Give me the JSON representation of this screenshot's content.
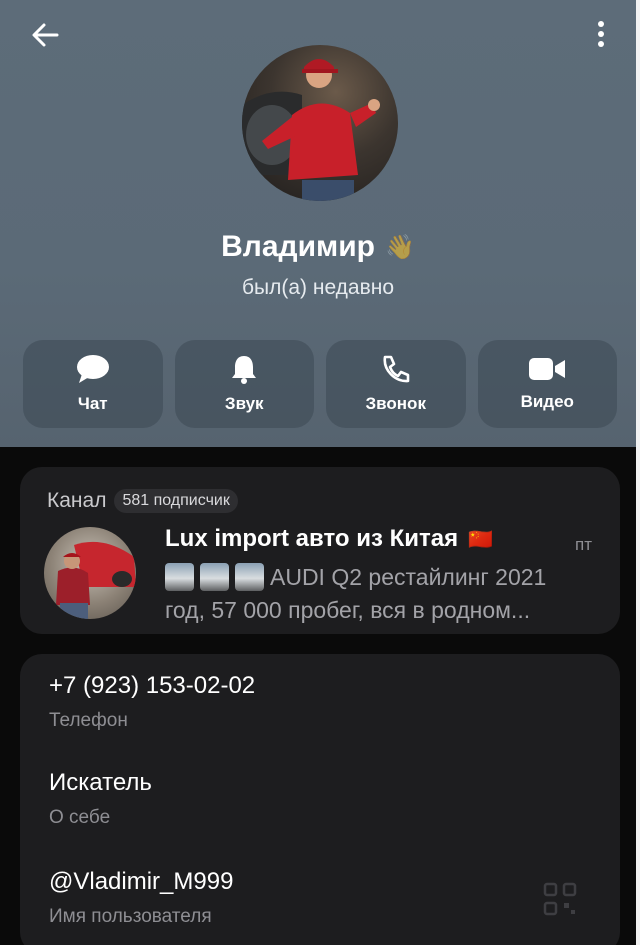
{
  "profile": {
    "name": "Владимир",
    "status": "был(а) недавно",
    "name_emoji": "👋"
  },
  "actions": [
    {
      "label": "Чат",
      "icon": "chat-bubble-icon"
    },
    {
      "label": "Звук",
      "icon": "bell-icon"
    },
    {
      "label": "Звонок",
      "icon": "phone-icon"
    },
    {
      "label": "Видео",
      "icon": "video-camera-icon"
    }
  ],
  "channel": {
    "section_title": "Канал",
    "subscribers": "581 подписчик",
    "name": "Lux import авто из Китая",
    "flag_emoji": "🇨🇳",
    "time": "пт",
    "preview_line1": "AUDI Q2 рестайлинг 2021",
    "preview_line2": "год, 57 000 пробег, вся в родном..."
  },
  "info": {
    "phone": {
      "value": "+7 (923) 153-02-02",
      "label": "Телефон"
    },
    "about": {
      "value": "Искатель",
      "label": "О себе"
    },
    "username": {
      "value": "@Vladimir_M999",
      "label": "Имя пользователя"
    }
  },
  "colors": {
    "header_bg": "#5d6c79",
    "page_bg": "#0a0a0a",
    "card_bg": "#1d1d1f",
    "secondary_text": "#8e8e93"
  },
  "icons": {
    "back": "arrow-left-icon",
    "menu": "more-vertical-icon",
    "qr": "qr-code-icon"
  }
}
